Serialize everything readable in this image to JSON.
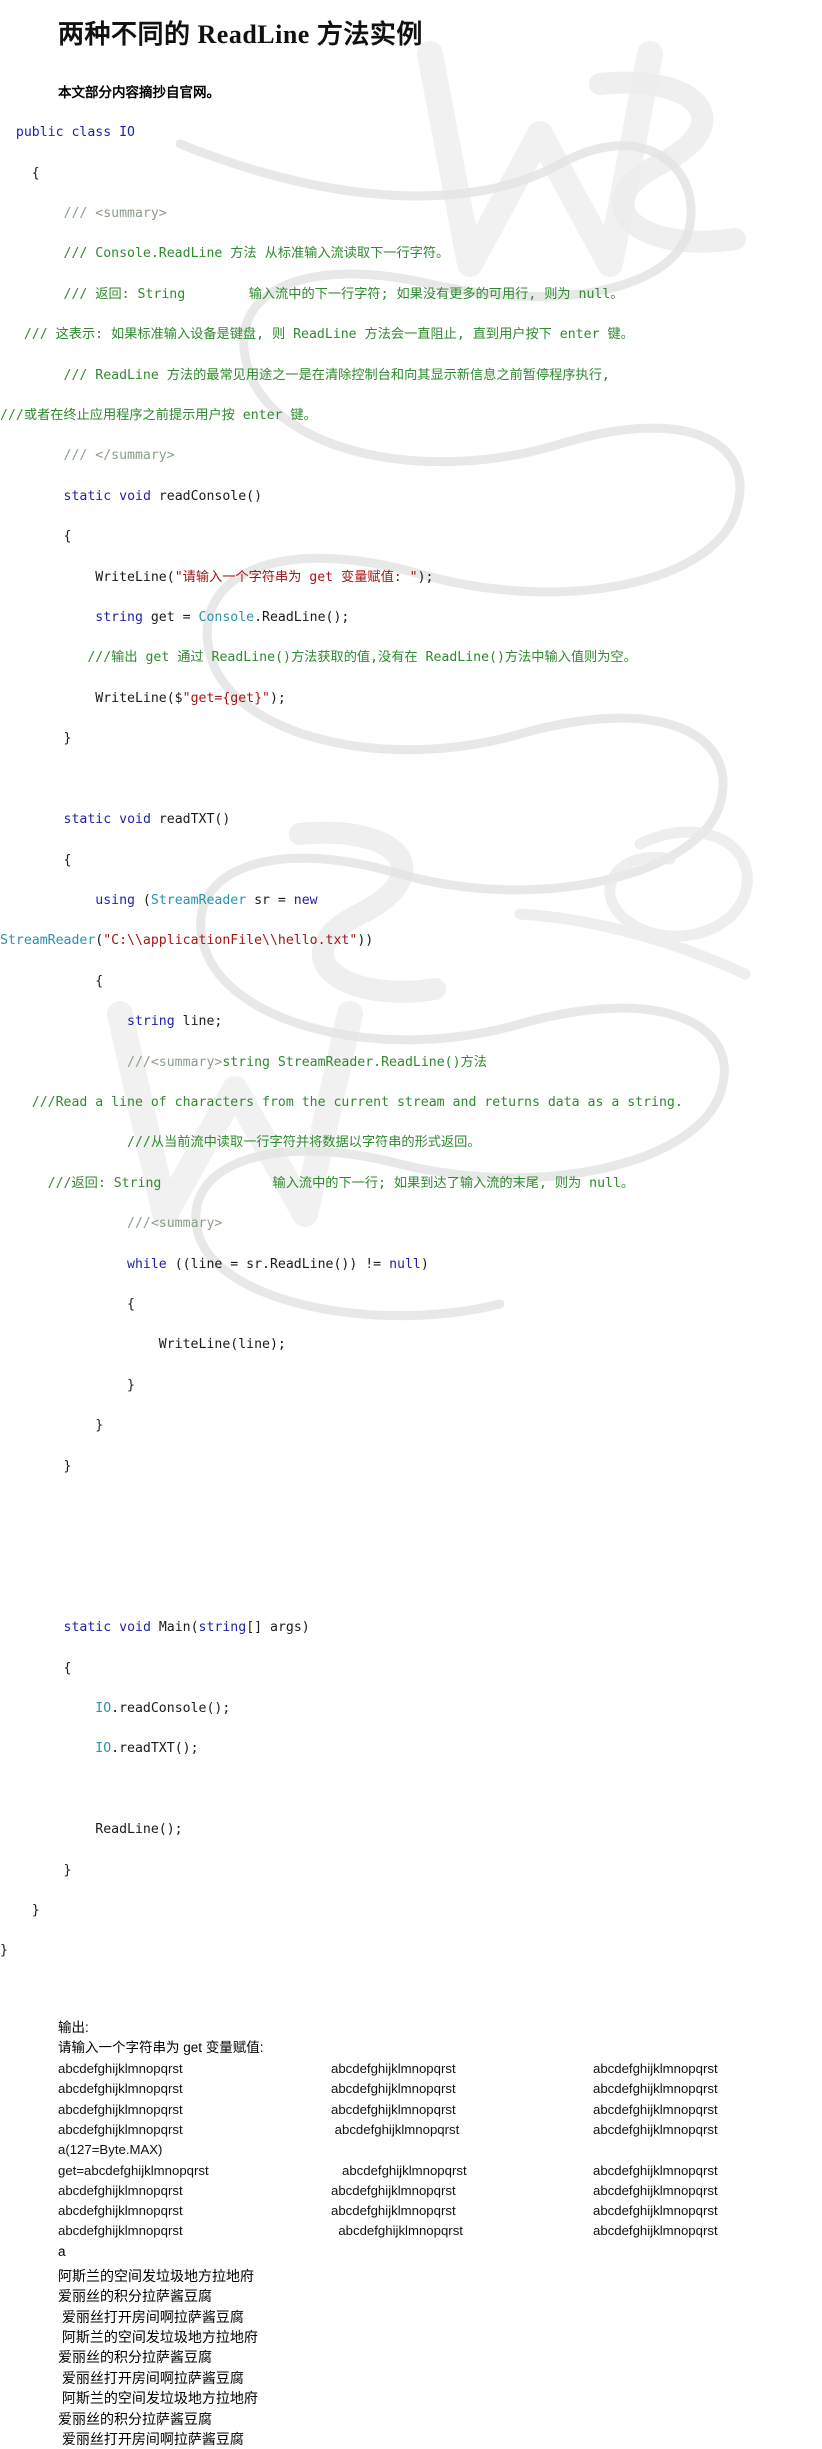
{
  "title": "两种不同的 ReadLine 方法实例",
  "intro": "本文部分内容摘抄自官网。",
  "code": {
    "l01": "public class IO",
    "l02": "{",
    "l03_c": "/// <summary>",
    "l04_c": "/// Console.ReadLine 方法 从标准输入流读取下一行字符。",
    "l05_c_a": "/// 返回: String",
    "l05_c_b": "输入流中的下一行字符; 如果没有更多的可用行, 则为 null。",
    "l06_c": "/// 这表示: 如果标准输入设备是键盘, 则 ReadLine 方法会一直阻止, 直到用户按下 enter 键。",
    "l07_c": "/// ReadLine 方法的最常见用途之一是在清除控制台和向其显示新信息之前暂停程序执行,",
    "l08_c": "///或者在终止应用程序之前提示用户按 enter 键。",
    "l09_c": "/// </summary>",
    "l10_kw1": "static",
    "l10_kw2": "void",
    "l10_name": "readConsole()",
    "l11": "{",
    "l12_call": "WriteLine(",
    "l12_str": "\"请输入一个字符串为 get 变量赋值: \"",
    "l12_end": ");",
    "l13_kw": "string",
    "l13_mid": " get = ",
    "l13_typ": "Console",
    "l13_end": ".ReadLine();",
    "l14_c": "///输出 get 通过 ReadLine()方法获取的值,没有在 ReadLine()方法中输入值则为空。",
    "l15_call": "WriteLine($",
    "l15_str": "\"get={get}\"",
    "l15_end": ");",
    "l16": "}",
    "l17_kw1": "static",
    "l17_kw2": "void",
    "l17_name": "readTXT()",
    "l18": "{",
    "l19_kw": "using",
    "l19_open": " (",
    "l19_typ": "StreamReader",
    "l19_mid": " sr = ",
    "l19_new": "new",
    "l20_typ": "StreamReader",
    "l20_open": "(",
    "l20_str": "\"C:\\\\applicationFile\\\\hello.txt\"",
    "l20_end": "))",
    "l21": "{",
    "l22_kw": "string",
    "l22_rest": " line;",
    "l23_a": "///<summary>",
    "l23_b": "string StreamReader.ReadLine()方法",
    "l24_c": "///Read a line of characters from the current stream and returns data as a string.",
    "l25_c": "///从当前流中读取一行字符并将数据以字符串的形式返回。",
    "l26_a": "///返回: String",
    "l26_b": "输入流中的下一行; 如果到达了输入流的末尾, 则为 null。",
    "l27_c": "///<summary>",
    "l28_kw": "while",
    "l28_mid": " ((line = sr.ReadLine()) != ",
    "l28_null": "null",
    "l28_end": ")",
    "l29": "{",
    "l30": "WriteLine(line);",
    "l31": "}",
    "l32": "}",
    "l33": "}",
    "l34_kw1": "static",
    "l34_kw2": "void",
    "l34_name": "Main(",
    "l34_kw3": "string",
    "l34_rest": "[] args)",
    "l35": "{",
    "l36_typ": "IO",
    "l36_rest": ".readConsole();",
    "l37_typ": "IO",
    "l37_rest": ".readTXT();",
    "l38": "ReadLine();",
    "l39": "}",
    "l40": "}",
    "l41": "}"
  },
  "output": {
    "label": "输出:",
    "prompt": "请输入一个字符串为 get 变量赋值:",
    "rows": [
      [
        "abcdefghijklmnopqrst",
        "abcdefghijklmnopqrst",
        "abcdefghijklmnopqrst"
      ],
      [
        "abcdefghijklmnopqrst",
        "abcdefghijklmnopqrst",
        "abcdefghijklmnopqrst"
      ],
      [
        "abcdefghijklmnopqrst",
        "abcdefghijklmnopqrst",
        "abcdefghijklmnopqrst"
      ],
      [
        "abcdefghijklmnopqrst",
        " abcdefghijklmnopqrst",
        "abcdefghijklmnopqrst"
      ],
      [
        "a(127=Byte.MAX)",
        "",
        ""
      ],
      [
        "get=abcdefghijklmnopqrst",
        "   abcdefghijklmnopqrst",
        "abcdefghijklmnopqrst"
      ],
      [
        "abcdefghijklmnopqrst",
        "abcdefghijklmnopqrst",
        "abcdefghijklmnopqrst"
      ],
      [
        "abcdefghijklmnopqrst",
        "abcdefghijklmnopqrst",
        "abcdefghijklmnopqrst"
      ],
      [
        "abcdefghijklmnopqrst",
        "  abcdefghijklmnopqrst",
        "abcdefghijklmnopqrst"
      ]
    ],
    "tail": "a",
    "cn_lines": [
      "阿斯兰的空间发垃圾地方拉地府",
      "爱丽丝的积分拉萨酱豆腐",
      " 爱丽丝打开房间啊拉萨酱豆腐",
      " 阿斯兰的空间发垃圾地方拉地府",
      "爱丽丝的积分拉萨酱豆腐",
      " 爱丽丝打开房间啊拉萨酱豆腐",
      " 阿斯兰的空间发垃圾地方拉地府",
      "爱丽丝的积分拉萨酱豆腐",
      " 爱丽丝打开房间啊拉萨酱豆腐"
    ]
  },
  "colors": {
    "keyword": "#1f1fa8",
    "type": "#2b91af",
    "string": "#a31515",
    "comment": "#2f8a2f",
    "comment_muted": "#8a9e8a",
    "text": "#1a1a1a"
  }
}
